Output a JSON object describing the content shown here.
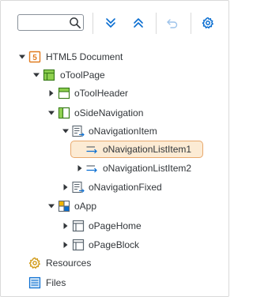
{
  "search": {
    "value": "",
    "placeholder": ""
  },
  "toolbar": {
    "expand_all_icon": "double-chevron-down-icon",
    "collapse_all_icon": "double-chevron-up-icon",
    "undo_icon": "undo-icon",
    "settings_icon": "gear-icon"
  },
  "tree": {
    "items": [
      {
        "label": "HTML5 Document",
        "icon": "html5-document-icon",
        "state": "expanded"
      },
      {
        "label": "oToolPage",
        "icon": "tool-page-icon",
        "state": "expanded"
      },
      {
        "label": "oToolHeader",
        "icon": "tool-header-icon",
        "state": "collapsed"
      },
      {
        "label": "oSideNavigation",
        "icon": "side-navigation-icon",
        "state": "expanded"
      },
      {
        "label": "oNavigationItem",
        "icon": "navigation-list-icon",
        "state": "expanded"
      },
      {
        "label": "oNavigationListItem1",
        "icon": "navigation-list-item-icon",
        "state": "leaf",
        "selected": true
      },
      {
        "label": "oNavigationListItem2",
        "icon": "navigation-list-item-icon",
        "state": "collapsed"
      },
      {
        "label": "oNavigationFixed",
        "icon": "navigation-list-icon",
        "state": "collapsed"
      },
      {
        "label": "oApp",
        "icon": "app-grid-icon",
        "state": "expanded"
      },
      {
        "label": "oPageHome",
        "icon": "page-icon",
        "state": "collapsed"
      },
      {
        "label": "oPageBlock",
        "icon": "page-icon",
        "state": "collapsed"
      }
    ],
    "resources_label": "Resources",
    "files_label": "Files"
  },
  "colors": {
    "accent": "#0a6ed1",
    "selection_fill": "#fcebd4",
    "selection_border": "#e8a86c",
    "html5_orange": "#e07b1f",
    "control_green": "#8fd14f",
    "control_green_dark": "#3a7d1a",
    "resources_gold": "#d19a17"
  }
}
